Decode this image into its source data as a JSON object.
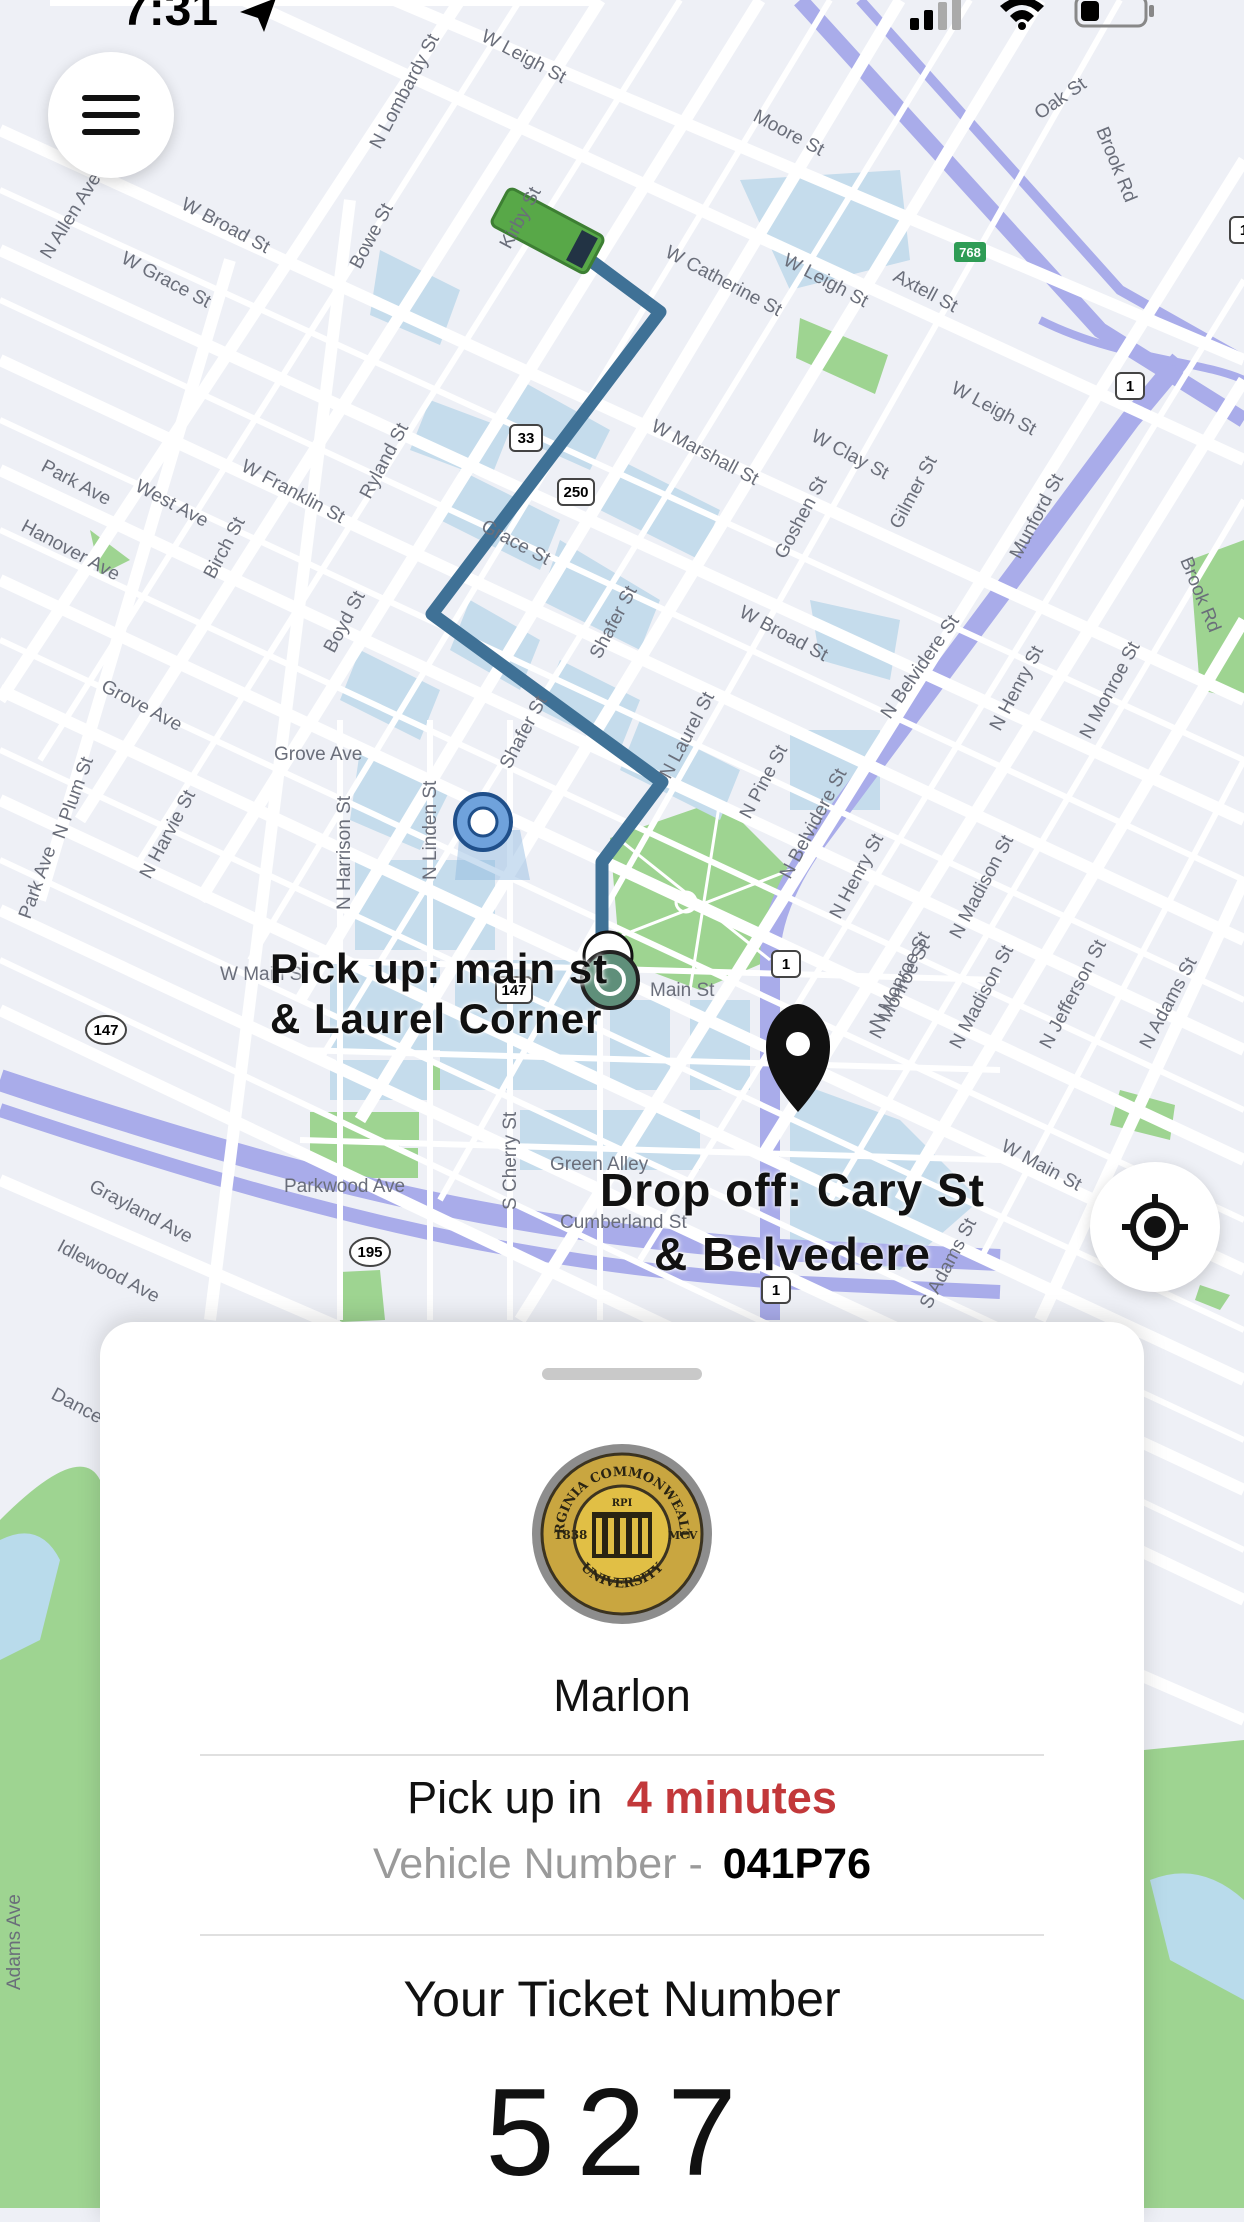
{
  "status_bar": {
    "time": "7:31"
  },
  "map": {
    "pickup_label_line1": "Pick up: main st",
    "pickup_label_line2": "& Laurel Corner",
    "dropoff_label_line1": "Drop off: Cary St",
    "dropoff_label_line2": "& Belvedere",
    "street_labels": [
      "N Lombardy St",
      "W Leigh St",
      "Moore St",
      "W Broad St",
      "W Grace St",
      "N Allen Ave",
      "Bowe St",
      "Kirby St",
      "W Catherine St",
      "W Leigh St",
      "Axtell St",
      "W Leigh St",
      "Oak St",
      "Brook Rd",
      "W Franklin St",
      "Ryland St",
      "W Marshall St",
      "W Clay St",
      "Goshen St",
      "Gilmer St",
      "Munford St",
      "Park Ave",
      "West Ave",
      "Birch St",
      "Hanover Ave",
      "Boyd St",
      "Grace St",
      "Shafer St",
      "W Broad St",
      "N Belvidere St",
      "N Henry St",
      "N Monroe St",
      "Grove Ave",
      "Grove Ave",
      "Shafer St",
      "N Laurel St",
      "N Pine St",
      "N Belvidere St",
      "N Harrison St",
      "N Linden St",
      "N Harvie St",
      "N Plum St",
      "Park Ave",
      "W Main St",
      "Main St",
      "N Monroe St",
      "N Madison St",
      "N Jefferson St",
      "N Adams St",
      "Parkwood Ave",
      "S Cherry St",
      "Green Alley",
      "Cumberland St",
      "Grayland Ave",
      "Idlewood Ave",
      "Dance St",
      "W Main St",
      "S Adams St",
      "N Henry St",
      "N Monroe St",
      "N Madison St",
      "Brook Rd",
      "Adams Ave"
    ],
    "shields": [
      "33",
      "250",
      "1",
      "1",
      "147",
      "147",
      "195",
      "1",
      "1",
      "768"
    ]
  },
  "sheet": {
    "seal_text_top": "VIRGINIA COMMONWEALTH",
    "seal_text_bottom": "UNIVERSITY",
    "seal_left": "1838",
    "seal_right": "MCV",
    "seal_mid": "RPI",
    "driver_name": "Marlon",
    "pickup_prefix": "Pick up in",
    "pickup_minutes": "4 minutes",
    "vehicle_label": "Vehicle Number -",
    "vehicle_number": "041P76",
    "ticket_label": "Your Ticket Number",
    "ticket_number": "527"
  },
  "colors": {
    "route": "#3f7196",
    "accent_red": "#c2383a",
    "highway": "#a9acea",
    "park": "#9ed491",
    "block": "#c5dcec"
  },
  "icons": [
    "hamburger-menu-icon",
    "locate-crosshair-icon",
    "dropoff-pin-icon",
    "pickup-marker-icon",
    "bus-icon",
    "user-location-icon"
  ]
}
